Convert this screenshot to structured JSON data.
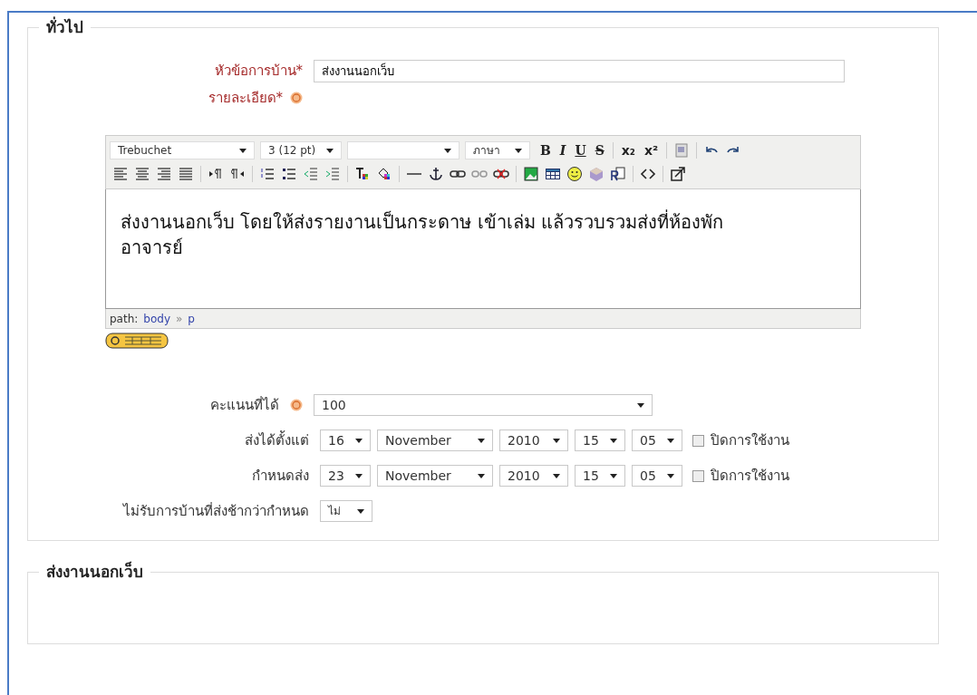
{
  "general": {
    "legend": "ทั่วไป",
    "title_field": {
      "label": "หัวข้อการบ้าน*",
      "value": "ส่งงานนอกเว็บ"
    },
    "description": {
      "label": "รายละเอียด*"
    },
    "editor": {
      "toolbar_row_1": [
        {
          "kind": "font-select",
          "value": "Trebuchet"
        },
        {
          "kind": "size-select",
          "value": "3 (12 pt)"
        },
        {
          "kind": "style-select"
        },
        {
          "kind": "lang-select",
          "value": "ภาษา"
        },
        {
          "kind": "bold",
          "text": "B"
        },
        {
          "kind": "italic",
          "text": "I"
        },
        {
          "kind": "underline",
          "text": "U"
        },
        {
          "kind": "strike",
          "text": "S"
        },
        {
          "kind": "sep"
        },
        {
          "kind": "subscript",
          "text": "x₂"
        },
        {
          "kind": "superscript",
          "text": "x²"
        },
        {
          "kind": "sep"
        },
        {
          "kind": "word-paste"
        },
        {
          "kind": "sep"
        },
        {
          "kind": "undo"
        },
        {
          "kind": "redo"
        }
      ],
      "toolbar_row_2": [
        {
          "kind": "align-left"
        },
        {
          "kind": "align-center"
        },
        {
          "kind": "align-right"
        },
        {
          "kind": "align-justify"
        },
        {
          "kind": "sep"
        },
        {
          "kind": "ltr"
        },
        {
          "kind": "rtl"
        },
        {
          "kind": "sep"
        },
        {
          "kind": "ordered-list"
        },
        {
          "kind": "bullet-list"
        },
        {
          "kind": "outdent"
        },
        {
          "kind": "indent"
        },
        {
          "kind": "sep"
        },
        {
          "kind": "text-color"
        },
        {
          "kind": "bg-color"
        },
        {
          "kind": "sep"
        },
        {
          "kind": "rule"
        },
        {
          "kind": "anchor"
        },
        {
          "kind": "link"
        },
        {
          "kind": "unlink"
        },
        {
          "kind": "nolink"
        },
        {
          "kind": "sep"
        },
        {
          "kind": "image"
        },
        {
          "kind": "table"
        },
        {
          "kind": "smiley"
        },
        {
          "kind": "cube"
        },
        {
          "kind": "find"
        },
        {
          "kind": "sep"
        },
        {
          "kind": "code"
        },
        {
          "kind": "sep"
        },
        {
          "kind": "fullscreen"
        }
      ],
      "content": "ส่งงานนอกเว็บ โดยให้ส่งรายงานเป็นกระดาษ เข้าเล่ม แล้วรวบรวมส่งที่ห้องพักอาจารย์",
      "path_label": "path:",
      "path": [
        "body",
        "p"
      ],
      "path_separator": "»"
    },
    "grade": {
      "label": "คะแนนที่ได้",
      "value": "100"
    },
    "dates": [
      {
        "label": "ส่งได้ตั้งแต่",
        "day": "16",
        "month": "November",
        "year": "2010",
        "hour": "15",
        "minute": "05",
        "disable_label": "ปิดการใช้งาน",
        "checked": false
      },
      {
        "label": "กำหนดส่ง",
        "day": "23",
        "month": "November",
        "year": "2010",
        "hour": "15",
        "minute": "05",
        "disable_label": "ปิดการใช้งาน",
        "checked": false
      }
    ],
    "prevent_late": {
      "label": "ไม่รับการบ้านที่ส่งช้ากว่ากำหนด",
      "value": "ไม่"
    }
  },
  "offline": {
    "legend": "ส่งงานนอกเว็บ"
  }
}
